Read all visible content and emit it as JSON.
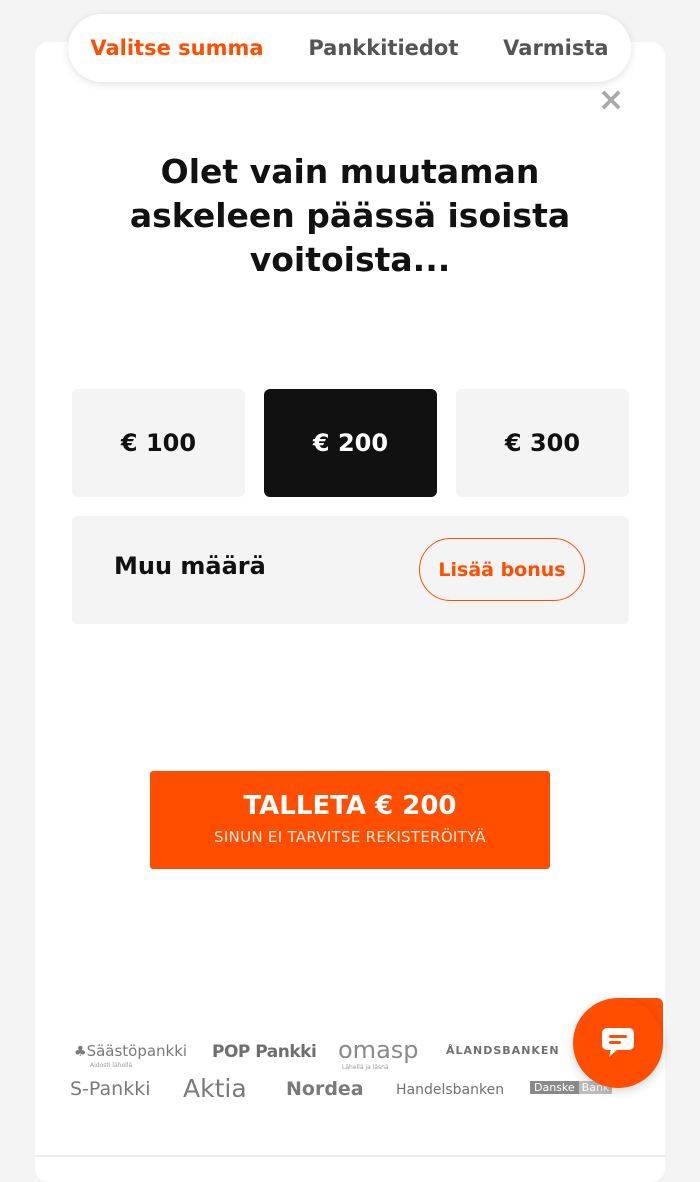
{
  "steps": [
    {
      "label": "Valitse summa",
      "active": true
    },
    {
      "label": "Pankkitiedot",
      "active": false
    },
    {
      "label": "Varmista",
      "active": false
    }
  ],
  "close_icon": "×",
  "headline": "Olet vain muutaman askeleen päässä isoista voitoista...",
  "amounts": [
    {
      "label": "€ 100",
      "selected": false
    },
    {
      "label": "€ 200",
      "selected": true
    },
    {
      "label": "€ 300",
      "selected": false
    }
  ],
  "other": {
    "label": "Muu määrä",
    "bonus_label": "Lisää bonus"
  },
  "cta": {
    "main": "TALLETA € 200",
    "sub": "SINUN EI TARVITSE REKISTERÖITYÄ"
  },
  "banks": {
    "saastopankki": "Säästöpankki",
    "saastopankki_tagline": "Aidosti lähellä",
    "pop": "POP Pankki",
    "omasp": "omasp",
    "omasp_tagline": "Lähellä ja läsnä",
    "alandsbanken": "ÅLANDSBANKEN",
    "spankki": "S-Pankki",
    "aktia": "Aktia",
    "nordea": "Nordea",
    "handelsbanken": "Handelsbanken",
    "danske": "Danske",
    "danske_bank": "Bank"
  },
  "colors": {
    "accent": "#ff4e00",
    "dark": "#111111",
    "tile": "#f4f4f4"
  },
  "chat_icon": "chat-bubble-icon"
}
